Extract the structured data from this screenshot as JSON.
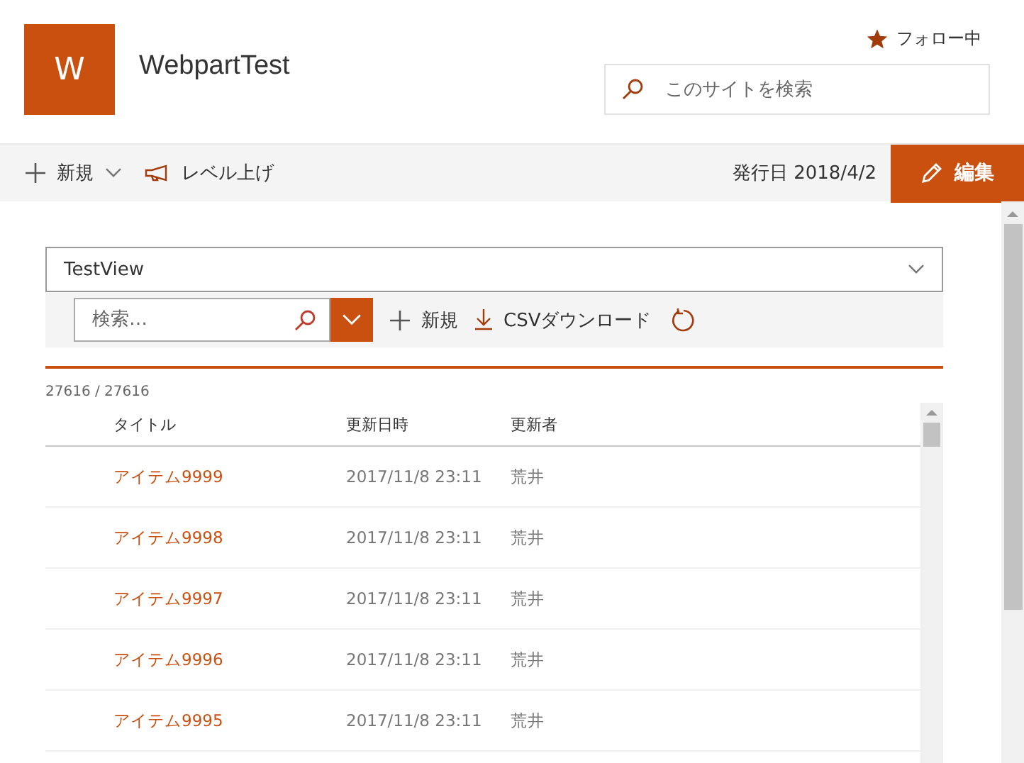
{
  "site": {
    "logo_letter": "W",
    "title": "WebpartTest",
    "follow": "フォロー中",
    "search": {
      "placeholder": "このサイトを検索"
    }
  },
  "command_bar": {
    "new": "新規",
    "promote": "レベル上げ",
    "published": "発行日 2018/4/2",
    "edit": "編集"
  },
  "webpart": {
    "view": "TestView",
    "search": {
      "placeholder": "検索…"
    },
    "new": "新規",
    "csv": "CSVダウンロード",
    "count": "27616 / 27616",
    "columns": [
      "タイトル",
      "更新日時",
      "更新者"
    ],
    "rows": [
      {
        "title": "アイテム9999",
        "modified": "2017/11/8 23:11",
        "editor": "荒井"
      },
      {
        "title": "アイテム9998",
        "modified": "2017/11/8 23:11",
        "editor": "荒井"
      },
      {
        "title": "アイテム9997",
        "modified": "2017/11/8 23:11",
        "editor": "荒井"
      },
      {
        "title": "アイテム9996",
        "modified": "2017/11/8 23:11",
        "editor": "荒井"
      },
      {
        "title": "アイテム9995",
        "modified": "2017/11/8 23:11",
        "editor": "荒井"
      }
    ]
  }
}
